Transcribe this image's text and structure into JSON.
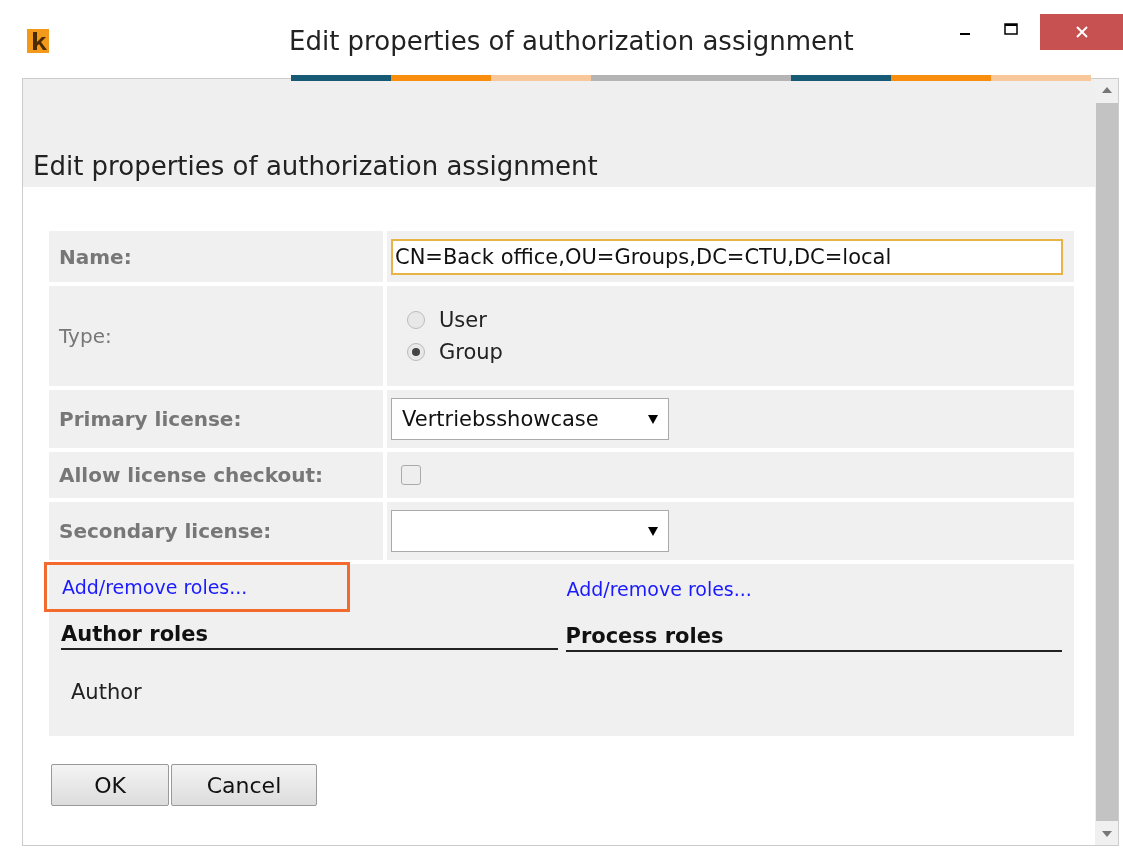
{
  "window": {
    "title": "Edit properties of authorization assignment"
  },
  "heading": "Edit properties of authorization assignment",
  "fields": [
    {
      "kind": "text",
      "label": "Name:",
      "bold": true,
      "value": "CN=Back office,OU=Groups,DC=CTU,DC=local",
      "focused": true
    },
    {
      "kind": "radio",
      "label": "Type:",
      "bold": false,
      "options": [
        {
          "label": "User",
          "selected": false
        },
        {
          "label": "Group",
          "selected": true
        }
      ]
    },
    {
      "kind": "select",
      "label": "Primary license:",
      "bold": true,
      "value": "Vertriebsshowcase"
    },
    {
      "kind": "checkbox",
      "label": "Allow license checkout:",
      "bold": true,
      "checked": false
    },
    {
      "kind": "select",
      "label": "Secondary license:",
      "bold": true
    }
  ],
  "role_columns": [
    {
      "link": "Add/remove roles...",
      "highlighted": true,
      "heading": "Author roles",
      "items": [
        "Author"
      ]
    },
    {
      "link": "Add/remove roles...",
      "highlighted": false,
      "heading": "Process roles"
    }
  ],
  "buttons": [
    "OK",
    "Cancel"
  ]
}
